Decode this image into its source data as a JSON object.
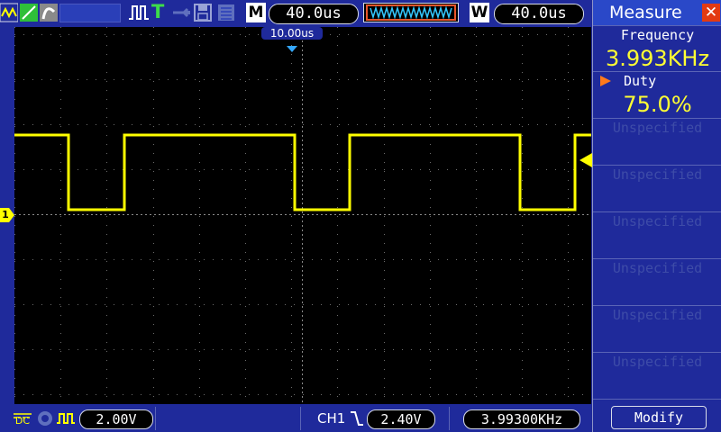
{
  "toolbar": {
    "timebase_mode_label": "M",
    "timebase_value": "40.0us",
    "window_mode_label": "W",
    "window_value": "40.0us",
    "trigger_status": "T"
  },
  "screen": {
    "trigger_position": "10.00us",
    "ch1_marker": "1"
  },
  "measure": {
    "title": "Measure",
    "close_label": "✕",
    "slots": [
      {
        "label": "Frequency",
        "value": "3.993KHz",
        "state": "active"
      },
      {
        "label": "Duty",
        "value": "75.0%",
        "state": "selected"
      },
      {
        "label": "Unspecified",
        "value": "",
        "state": "inactive"
      },
      {
        "label": "Unspecified",
        "value": "",
        "state": "inactive"
      },
      {
        "label": "Unspecified",
        "value": "",
        "state": "inactive"
      },
      {
        "label": "Unspecified",
        "value": "",
        "state": "inactive"
      },
      {
        "label": "Unspecified",
        "value": "",
        "state": "inactive"
      },
      {
        "label": "Unspecified",
        "value": "",
        "state": "inactive"
      }
    ],
    "modify_label": "Modify"
  },
  "bottom": {
    "coupling": "DC",
    "volts_per_div": "2.00V",
    "trigger_channel": "CH1",
    "trigger_level": "2.40V",
    "frequency_counter": "3.99300KHz"
  },
  "colors": {
    "trace": "#ffff00",
    "panel_bg": "#1f2a9b",
    "measure_value": "#ffff33",
    "close_button": "#e33a12"
  }
}
